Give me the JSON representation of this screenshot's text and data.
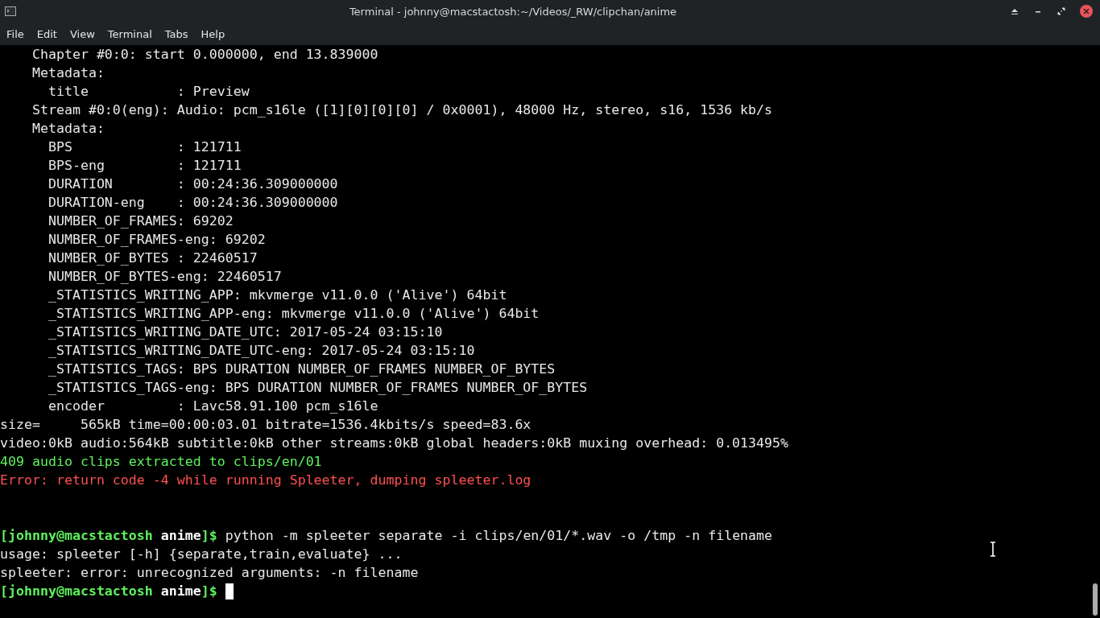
{
  "window": {
    "title": "Terminal - johnny@macstactosh:~/Videos/_RW/clipchan/anime"
  },
  "menu": [
    "File",
    "Edit",
    "View",
    "Terminal",
    "Tabs",
    "Help"
  ],
  "lines": [
    {
      "kind": "plain",
      "text": "    Chapter #0:0: start 0.000000, end 13.839000"
    },
    {
      "kind": "plain",
      "text": "    Metadata:"
    },
    {
      "kind": "plain",
      "text": "      title           : Preview"
    },
    {
      "kind": "plain",
      "text": "    Stream #0:0(eng): Audio: pcm_s16le ([1][0][0][0] / 0x0001), 48000 Hz, stereo, s16, 1536 kb/s"
    },
    {
      "kind": "plain",
      "text": "    Metadata:"
    },
    {
      "kind": "plain",
      "text": "      BPS             : 121711"
    },
    {
      "kind": "plain",
      "text": "      BPS-eng         : 121711"
    },
    {
      "kind": "plain",
      "text": "      DURATION        : 00:24:36.309000000"
    },
    {
      "kind": "plain",
      "text": "      DURATION-eng    : 00:24:36.309000000"
    },
    {
      "kind": "plain",
      "text": "      NUMBER_OF_FRAMES: 69202"
    },
    {
      "kind": "plain",
      "text": "      NUMBER_OF_FRAMES-eng: 69202"
    },
    {
      "kind": "plain",
      "text": "      NUMBER_OF_BYTES : 22460517"
    },
    {
      "kind": "plain",
      "text": "      NUMBER_OF_BYTES-eng: 22460517"
    },
    {
      "kind": "plain",
      "text": "      _STATISTICS_WRITING_APP: mkvmerge v11.0.0 ('Alive') 64bit"
    },
    {
      "kind": "plain",
      "text": "      _STATISTICS_WRITING_APP-eng: mkvmerge v11.0.0 ('Alive') 64bit"
    },
    {
      "kind": "plain",
      "text": "      _STATISTICS_WRITING_DATE_UTC: 2017-05-24 03:15:10"
    },
    {
      "kind": "plain",
      "text": "      _STATISTICS_WRITING_DATE_UTC-eng: 2017-05-24 03:15:10"
    },
    {
      "kind": "plain",
      "text": "      _STATISTICS_TAGS: BPS DURATION NUMBER_OF_FRAMES NUMBER_OF_BYTES"
    },
    {
      "kind": "plain",
      "text": "      _STATISTICS_TAGS-eng: BPS DURATION NUMBER_OF_FRAMES NUMBER_OF_BYTES"
    },
    {
      "kind": "plain",
      "text": "      encoder         : Lavc58.91.100 pcm_s16le"
    },
    {
      "kind": "plain",
      "text": "size=     565kB time=00:00:03.01 bitrate=1536.4kbits/s speed=83.6x"
    },
    {
      "kind": "plain",
      "text": "video:0kB audio:564kB subtitle:0kB other streams:0kB global headers:0kB muxing overhead: 0.013495%"
    },
    {
      "kind": "success",
      "text": "409 audio clips extracted to clips/en/01"
    },
    {
      "kind": "error",
      "text": "Error: return code -4 while running Spleeter, dumping spleeter.log"
    },
    {
      "kind": "blank"
    },
    {
      "kind": "blank"
    },
    {
      "kind": "prompt",
      "user": "[johnny@macstactosh",
      "dir": "anime",
      "end": "]$",
      "text": "python -m spleeter separate -i clips/en/01/*.wav -o /tmp -n filename"
    },
    {
      "kind": "plain",
      "text": "usage: spleeter [-h] {separate,train,evaluate} ..."
    },
    {
      "kind": "plain",
      "text": "spleeter: error: unrecognized arguments: -n filename"
    },
    {
      "kind": "prompt",
      "user": "[johnny@macstactosh",
      "dir": "anime",
      "end": "]$",
      "cursor": true
    }
  ]
}
